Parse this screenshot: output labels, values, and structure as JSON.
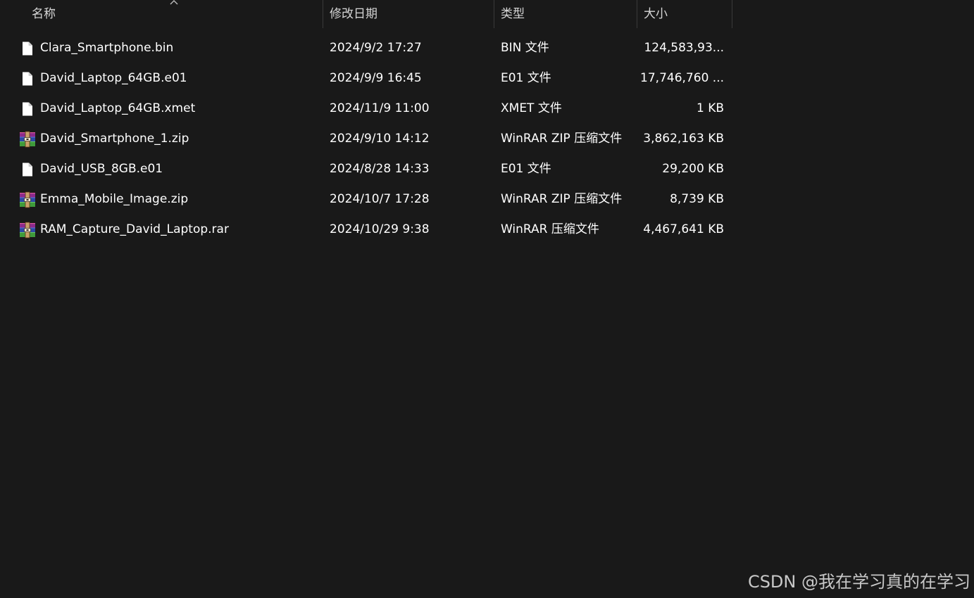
{
  "columns": {
    "name": "名称",
    "date": "修改日期",
    "type": "类型",
    "size": "大小"
  },
  "files": [
    {
      "name": "Clara_Smartphone.bin",
      "date": "2024/9/2 17:27",
      "type": "BIN 文件",
      "size": "124,583,93...",
      "icon": "file-icon"
    },
    {
      "name": "David_Laptop_64GB.e01",
      "date": "2024/9/9 16:45",
      "type": "E01 文件",
      "size": "17,746,760 ...",
      "icon": "file-icon"
    },
    {
      "name": "David_Laptop_64GB.xmet",
      "date": "2024/11/9 11:00",
      "type": "XMET 文件",
      "size": "1 KB",
      "icon": "file-icon"
    },
    {
      "name": "David_Smartphone_1.zip",
      "date": "2024/9/10 14:12",
      "type": "WinRAR ZIP 压缩文件",
      "size": "3,862,163 KB",
      "icon": "winrar-icon"
    },
    {
      "name": "David_USB_8GB.e01",
      "date": "2024/8/28 14:33",
      "type": "E01 文件",
      "size": "29,200 KB",
      "icon": "file-icon"
    },
    {
      "name": "Emma_Mobile_Image.zip",
      "date": "2024/10/7 17:28",
      "type": "WinRAR ZIP 压缩文件",
      "size": "8,739 KB",
      "icon": "winrar-icon"
    },
    {
      "name": "RAM_Capture_David_Laptop.rar",
      "date": "2024/10/29 9:38",
      "type": "WinRAR 压缩文件",
      "size": "4,467,641 KB",
      "icon": "winrar-icon"
    }
  ],
  "watermark": "CSDN @我在学习真的在学习",
  "colors": {
    "background": "#191919",
    "text": "#ffffff",
    "header_text": "#d6d6d6",
    "separator": "#3a3a3a"
  }
}
